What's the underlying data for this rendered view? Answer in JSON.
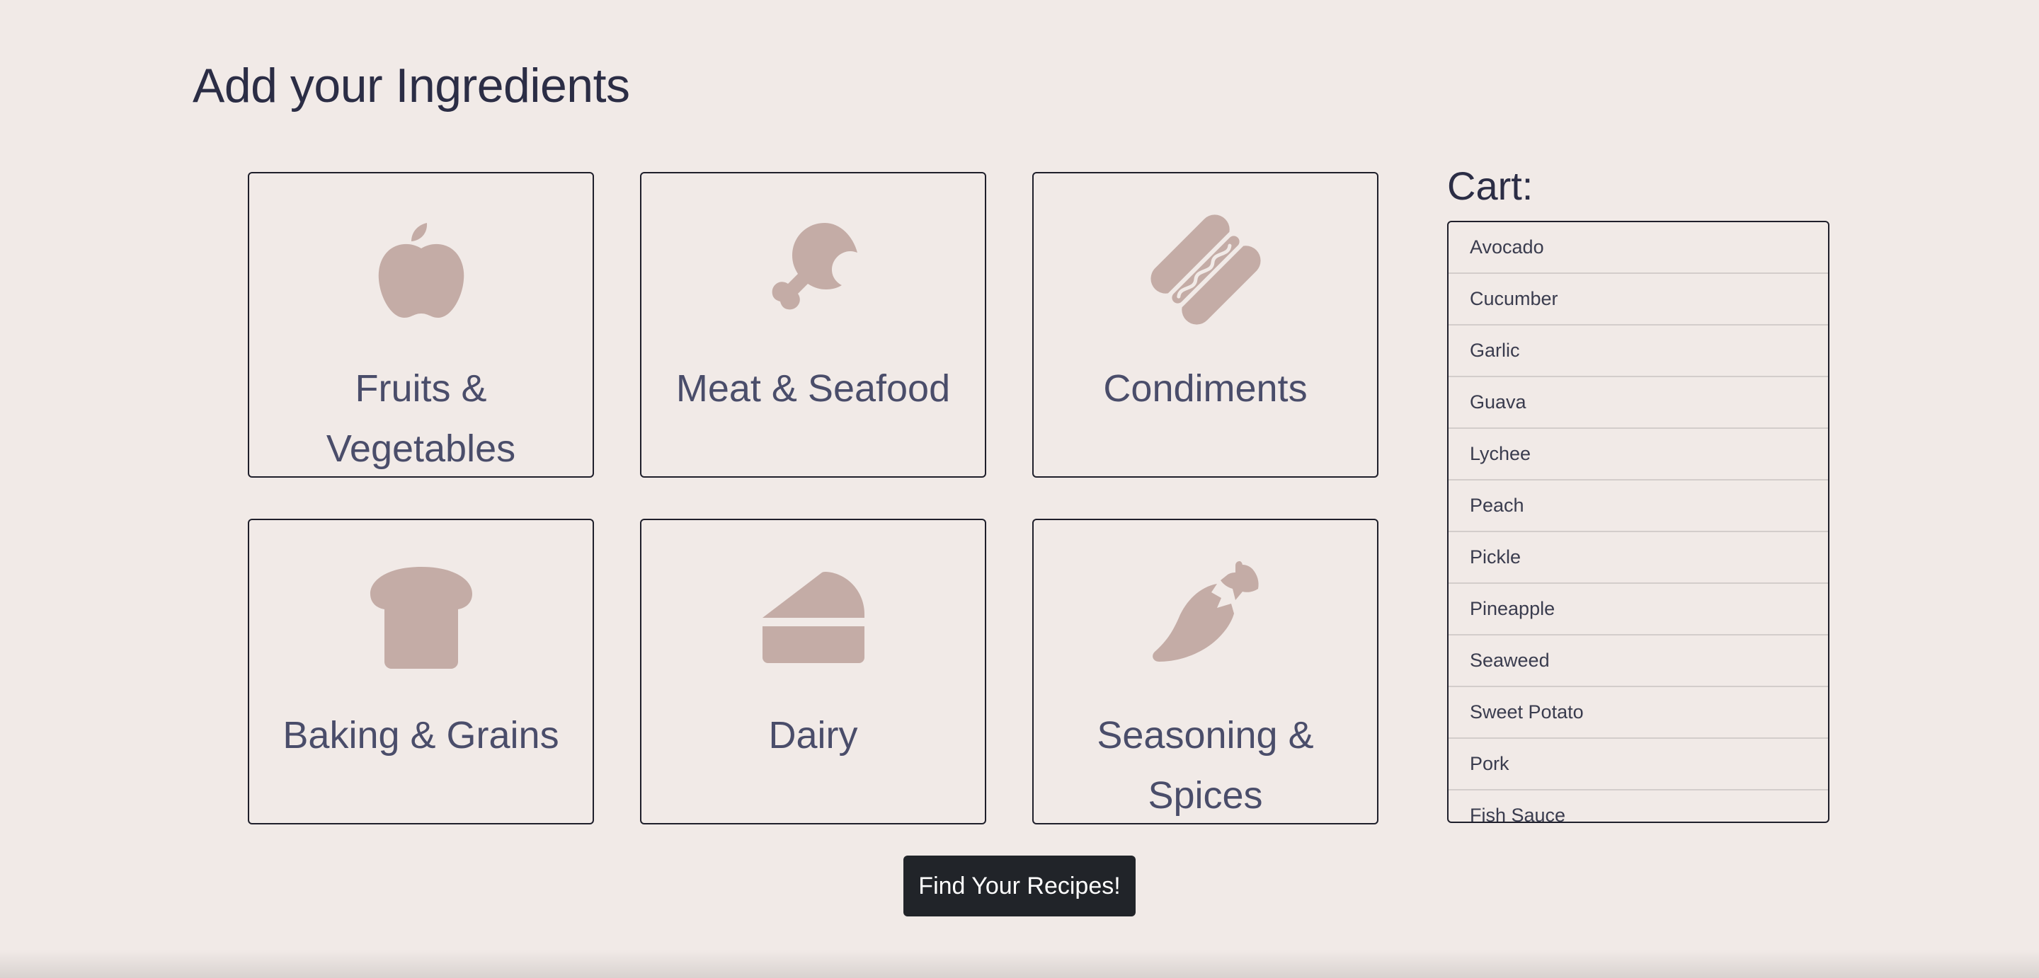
{
  "page": {
    "title": "Add your Ingredients"
  },
  "categories": [
    {
      "label": "Fruits & Vegetables",
      "icon": "apple-icon"
    },
    {
      "label": "Meat & Seafood",
      "icon": "drumstick-icon"
    },
    {
      "label": "Condiments",
      "icon": "hotdog-icon"
    },
    {
      "label": "Baking & Grains",
      "icon": "bread-icon"
    },
    {
      "label": "Dairy",
      "icon": "cheese-icon"
    },
    {
      "label": "Seasoning & Spices",
      "icon": "pepper-icon"
    }
  ],
  "cart": {
    "title": "Cart:",
    "items": [
      "Avocado",
      "Cucumber",
      "Garlic",
      "Guava",
      "Lychee",
      "Peach",
      "Pickle",
      "Pineapple",
      "Seaweed",
      "Sweet Potato",
      "Pork",
      "Fish Sauce"
    ]
  },
  "actions": {
    "find_label": "Find Your Recipes!"
  },
  "colors": {
    "background": "#f1eae7",
    "icon": "#c4aca6",
    "text": "#4a4d6a",
    "button": "#212429"
  }
}
